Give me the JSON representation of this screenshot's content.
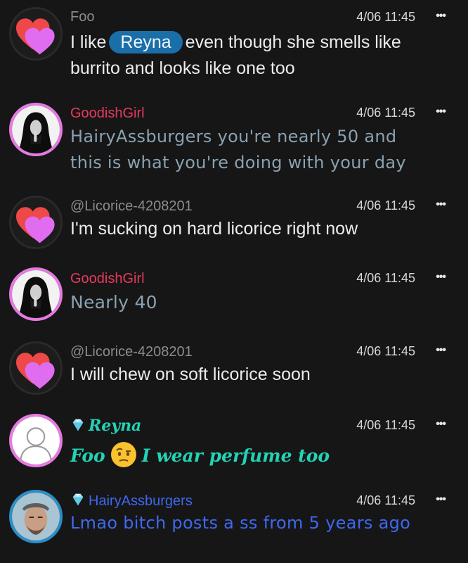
{
  "colors": {
    "background": "#161616",
    "user_grey": "#8c8c8c",
    "user_pink": "#e8395f",
    "user_teal": "#22d3b5",
    "user_blue": "#3e68f0",
    "mention_bg": "#1a6fa8"
  },
  "messages": [
    {
      "username": "Foo",
      "time": "4/06 11:45",
      "avatar": "heart-icon",
      "text_line1_before": "I like",
      "mention": "Reyna",
      "text_line1_after": "even though she smells like",
      "text_line2": "burrito and looks like one too"
    },
    {
      "username": "GoodishGirl",
      "time": "4/06 11:45",
      "avatar": "nun-photo",
      "text_line1": "HairyAssburgers you're nearly 50 and",
      "text_line2": "this is what you're doing with your day"
    },
    {
      "username": "@Licorice-4208201",
      "time": "4/06 11:45",
      "avatar": "heart-icon",
      "text": "I'm sucking on hard licorice right now"
    },
    {
      "username": "GoodishGirl",
      "time": "4/06 11:45",
      "avatar": "nun-photo",
      "text": "Nearly 40"
    },
    {
      "username": "@Licorice-4208201",
      "time": "4/06 11:45",
      "avatar": "heart-icon",
      "text": "I will chew on soft licorice soon"
    },
    {
      "username": "Reyna",
      "time": "4/06 11:45",
      "avatar": "default-user-icon",
      "badge": "diamond-icon",
      "text_before": "Foo",
      "emoji": "face-with-raised-eyebrow-emoji",
      "text_after": "I wear perfume too"
    },
    {
      "username": "HairyAssburgers",
      "time": "4/06 11:45",
      "avatar": "man-photo",
      "badge": "diamond-icon",
      "text": "Lmao bitch posts a ss from 5 years ago"
    }
  ]
}
